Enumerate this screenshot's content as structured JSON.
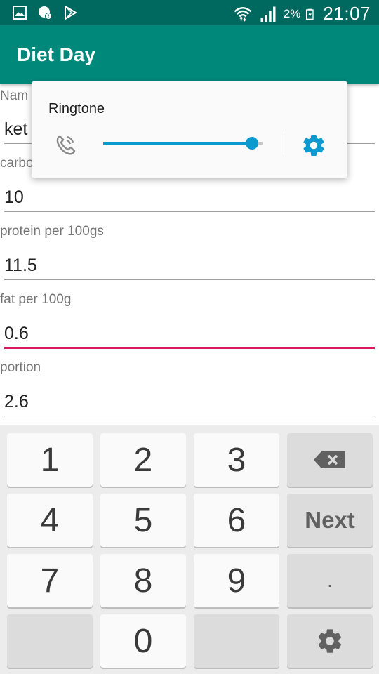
{
  "status_bar": {
    "icons_left": [
      "gallery-icon",
      "chat-icon",
      "play-store-icon"
    ],
    "icons_right": [
      "wifi-icon",
      "signal-icon",
      "battery-icon"
    ],
    "battery_percent": "2%",
    "time": "21:07",
    "color": "#00695f"
  },
  "app_bar": {
    "title": "Diet Day",
    "color": "#00897b"
  },
  "form": {
    "fields": [
      {
        "label": "Nam",
        "value": "ket"
      },
      {
        "label": "carbo",
        "value": "10"
      },
      {
        "label": "protein per 100gs",
        "value": "11.5"
      },
      {
        "label": "fat per 100g",
        "value": "0.6",
        "focused": true
      },
      {
        "label": "portion",
        "value": "2.6"
      }
    ],
    "focus_color": "#d81b60"
  },
  "volume_popup": {
    "title": "Ringtone",
    "icon": "ringtone-icon",
    "slider_level": 0.93,
    "accent_color": "#0a9ad0",
    "settings_icon": "gear-icon"
  },
  "keyboard": {
    "keys": [
      {
        "label": "1",
        "type": "digit"
      },
      {
        "label": "2",
        "type": "digit"
      },
      {
        "label": "3",
        "type": "digit"
      },
      {
        "label": "",
        "type": "backspace",
        "icon": "backspace-icon"
      },
      {
        "label": "4",
        "type": "digit"
      },
      {
        "label": "5",
        "type": "digit"
      },
      {
        "label": "6",
        "type": "digit"
      },
      {
        "label": "Next",
        "type": "next"
      },
      {
        "label": "7",
        "type": "digit"
      },
      {
        "label": "8",
        "type": "digit"
      },
      {
        "label": "9",
        "type": "digit"
      },
      {
        "label": ".",
        "type": "dot"
      },
      {
        "label": "",
        "type": "blank"
      },
      {
        "label": "0",
        "type": "digit"
      },
      {
        "label": "",
        "type": "blank"
      },
      {
        "label": "",
        "type": "settings",
        "icon": "gear-icon"
      }
    ]
  }
}
